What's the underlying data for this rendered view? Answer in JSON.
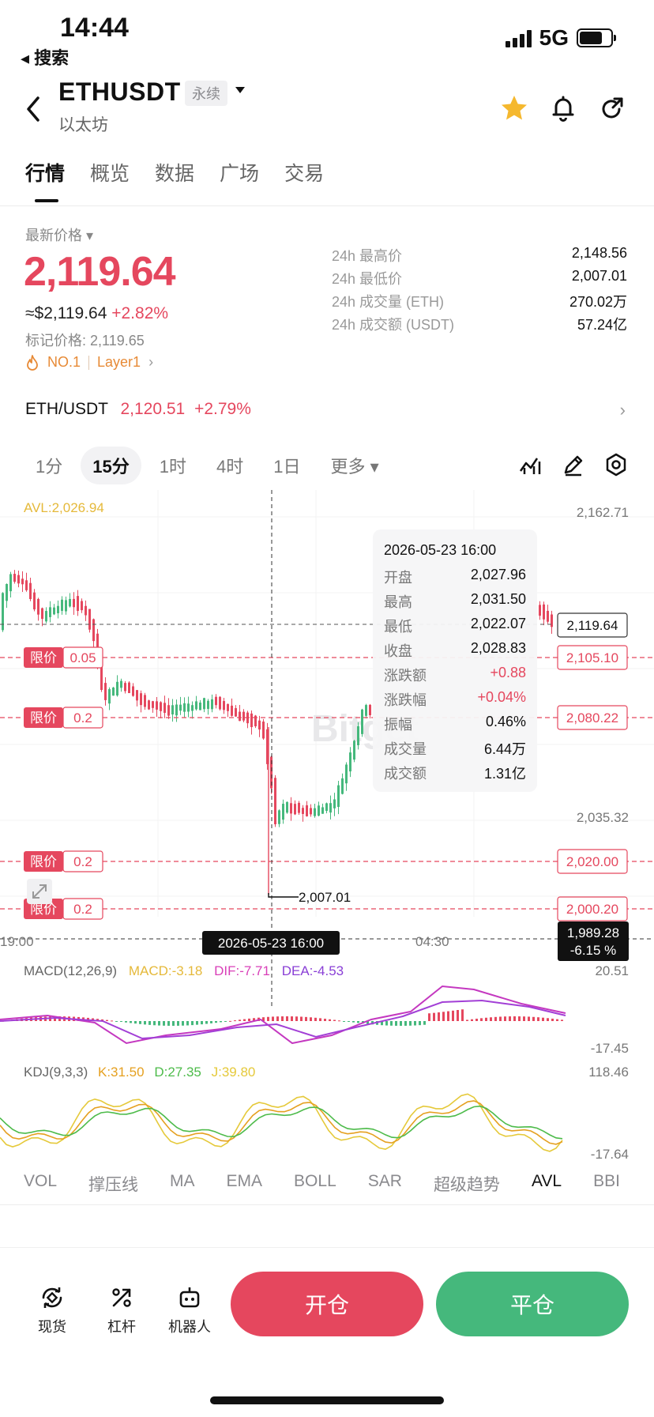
{
  "status_bar": {
    "time": "14:44",
    "back_app": "◂ 搜索",
    "network": "5G"
  },
  "header": {
    "symbol": "ETHUSDT",
    "badge": "永续",
    "subtitle": "以太坊"
  },
  "tabs": [
    {
      "label": "行情",
      "active": true
    },
    {
      "label": "概览",
      "active": false
    },
    {
      "label": "数据",
      "active": false
    },
    {
      "label": "广场",
      "active": false
    },
    {
      "label": "交易",
      "active": false
    }
  ],
  "ticker": {
    "price_label": "最新价格 ▾",
    "last_price": "2,119.64",
    "usd_price": "≈$2,119.64",
    "change_pct": "+2.82%",
    "mark_price": "标记价格: 2,119.65",
    "rank_tag": "NO.1",
    "sector_tag": "Layer1",
    "stats": [
      {
        "label": "24h 最高价",
        "value": "2,148.56"
      },
      {
        "label": "24h 最低价",
        "value": "2,007.01"
      },
      {
        "label": "24h 成交量 (ETH)",
        "value": "270.02万"
      },
      {
        "label": "24h 成交额 (USDT)",
        "value": "57.24亿"
      }
    ]
  },
  "spot": {
    "pair": "ETH/USDT",
    "price": "2,120.51",
    "change": "+2.79%"
  },
  "intervals": [
    {
      "label": "1分",
      "active": false
    },
    {
      "label": "15分",
      "active": true
    },
    {
      "label": "1时",
      "active": false
    },
    {
      "label": "4时",
      "active": false
    },
    {
      "label": "1日",
      "active": false
    },
    {
      "label": "更多 ▾",
      "active": false
    }
  ],
  "chart": {
    "avl_label": "AVL:2,026.94",
    "price_axis": [
      "2,162.71",
      "2,035.32"
    ],
    "current_price": "2,119.64",
    "crosshair_price": "1,989.28",
    "crosshair_pct": "-6.15 %",
    "crosshair_time": "2026-05-23 16:00",
    "low_marker": "2,007.01",
    "time_labels": [
      "19:00",
      "04:30"
    ],
    "watermark": "Bitget",
    "orders": [
      {
        "tag": "限价",
        "qty": "0.05",
        "price": "2,105.10"
      },
      {
        "tag": "限价",
        "qty": "0.2",
        "price": "2,080.22"
      },
      {
        "tag": "限价",
        "qty": "0.2",
        "price": "2,020.00"
      },
      {
        "tag": "限价",
        "qty": "0.2",
        "price": "2,000.20"
      }
    ],
    "tooltip": {
      "date": "2026-05-23 16:00",
      "rows": [
        {
          "label": "开盘",
          "value": "2,027.96"
        },
        {
          "label": "最高",
          "value": "2,031.50"
        },
        {
          "label": "最低",
          "value": "2,022.07"
        },
        {
          "label": "收盘",
          "value": "2,028.83"
        },
        {
          "label": "涨跌额",
          "value": "+0.88"
        },
        {
          "label": "涨跌幅",
          "value": "+0.04%"
        },
        {
          "label": "振幅",
          "value": "0.46%"
        },
        {
          "label": "成交量",
          "value": "6.44万"
        },
        {
          "label": "成交额",
          "value": "1.31亿"
        }
      ]
    },
    "macd": {
      "title": "MACD(12,26,9)",
      "macd": "MACD:-3.18",
      "dif": "DIF:-7.71",
      "dea": "DEA:-4.53",
      "max": "20.51",
      "min": "-17.45"
    },
    "kdj": {
      "title": "KDJ(9,3,3)",
      "k": "K:31.50",
      "d": "D:27.35",
      "j": "J:39.80",
      "max": "118.46",
      "min": "-17.64"
    },
    "colors": {
      "up": "#e5475e",
      "down": "#45b87c",
      "avl": "#e5b93a",
      "macd_line": "#c438c0",
      "dea_line": "#a23fd6"
    }
  },
  "indicator_tabs": [
    {
      "label": "VOL",
      "active": false
    },
    {
      "label": "撑压线",
      "active": false
    },
    {
      "label": "MA",
      "active": false
    },
    {
      "label": "EMA",
      "active": false
    },
    {
      "label": "BOLL",
      "active": false
    },
    {
      "label": "SAR",
      "active": false
    },
    {
      "label": "超级趋势",
      "active": false
    },
    {
      "label": "AVL",
      "active": true
    },
    {
      "label": "BBI",
      "active": false
    }
  ],
  "bottom": {
    "spot": "现货",
    "leverage": "杠杆",
    "robot": "机器人",
    "open": "开仓",
    "close": "平仓"
  }
}
